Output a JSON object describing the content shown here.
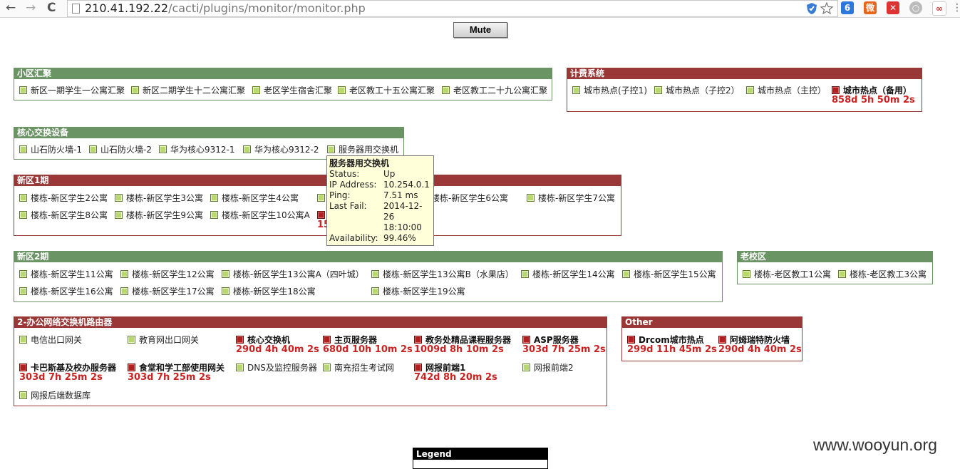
{
  "browser": {
    "url_host": "210.41.192.22",
    "url_path": "/cacti/plugins/monitor/monitor.php",
    "nav_back": "←",
    "nav_forward": "→",
    "nav_reload": "C"
  },
  "mute_label": "Mute",
  "colors": {
    "up_group": "#6b9465",
    "down_group": "#9a3838",
    "down_time": "#cc2222"
  },
  "groups": {
    "g1": {
      "title": "小区汇聚",
      "devices": [
        {
          "name": "新区一期学生一公寓汇聚",
          "status": "up"
        },
        {
          "name": "新区二期学生十二公寓汇聚",
          "status": "up"
        },
        {
          "name": "老区学生宿舍汇聚",
          "status": "up"
        },
        {
          "name": "老区教工十五公寓汇聚",
          "status": "up"
        },
        {
          "name": "老区教工二十九公寓汇聚",
          "status": "up"
        }
      ]
    },
    "g2": {
      "title": "计费系统",
      "devices": [
        {
          "name": "城市热点(子控1)",
          "status": "up"
        },
        {
          "name": "城市热点（子控2）",
          "status": "up"
        },
        {
          "name": "城市热点（主控）",
          "status": "up"
        },
        {
          "name": "城市热点（备用）",
          "status": "down",
          "downtime": "858d 5h 50m 2s"
        }
      ]
    },
    "g3": {
      "title": "核心交换设备",
      "devices": [
        {
          "name": "山石防火墙-1",
          "status": "up"
        },
        {
          "name": "山石防火墙-2",
          "status": "up"
        },
        {
          "name": "华为核心9312-1",
          "status": "up"
        },
        {
          "name": "华为核心9312-2",
          "status": "up"
        },
        {
          "name": "服务器用交换机",
          "status": "up"
        }
      ]
    },
    "g4": {
      "title": "新区1期",
      "devices": [
        {
          "name": "楼栋-新区学生2公寓",
          "status": "up"
        },
        {
          "name": "楼栋-新区学生3公寓",
          "status": "up"
        },
        {
          "name": "楼栋-新区学生4公寓",
          "status": "up"
        },
        {
          "name": "",
          "status": "up"
        },
        {
          "name": "楼栋-新区学生6公寓",
          "status": "up"
        },
        {
          "name": "楼栋-新区学生7公寓",
          "status": "up"
        },
        {
          "name": "楼栋-新区学生8公寓",
          "status": "up"
        },
        {
          "name": "楼栋-新区学生9公寓",
          "status": "up"
        },
        {
          "name": "楼栋-新区学生10公寓A",
          "status": "up"
        },
        {
          "name": "",
          "status": "down",
          "downtime": "15"
        }
      ]
    },
    "g5": {
      "title": "新区2期",
      "devices": [
        {
          "name": "楼栋-新区学生11公寓",
          "status": "up"
        },
        {
          "name": "楼栋-新区学生12公寓",
          "status": "up"
        },
        {
          "name": "楼栋-新区学生13公寓A（四叶城）",
          "status": "up"
        },
        {
          "name": "楼栋-新区学生13公寓B（水果店）",
          "status": "up"
        },
        {
          "name": "楼栋-新区学生14公寓",
          "status": "up"
        },
        {
          "name": "楼栋-新区学生15公寓",
          "status": "up"
        },
        {
          "name": "楼栋-新区学生16公寓",
          "status": "up"
        },
        {
          "name": "楼栋-新区学生17公寓",
          "status": "up"
        },
        {
          "name": "楼栋-新区学生18公寓",
          "status": "up"
        },
        {
          "name": "楼栋-新区学生19公寓",
          "status": "up"
        }
      ]
    },
    "g6": {
      "title": "老校区",
      "devices": [
        {
          "name": "楼栋-老区教工1公寓",
          "status": "up"
        },
        {
          "name": "楼栋-老区教工3公寓",
          "status": "up"
        }
      ]
    },
    "g7": {
      "title": "2-办公网络交换机路由器",
      "devices": [
        {
          "name": "电信出口网关",
          "status": "up"
        },
        {
          "name": "教育网出口网关",
          "status": "up"
        },
        {
          "name": "核心交换机",
          "status": "down",
          "downtime": "290d 4h 40m 2s"
        },
        {
          "name": "主页服务器",
          "status": "down",
          "downtime": "680d 10h 10m 2s"
        },
        {
          "name": "教务处精品课程服务器",
          "status": "down",
          "downtime": "1009d 8h 10m 2s"
        },
        {
          "name": "ASP服务器",
          "status": "down",
          "downtime": "303d 7h 25m 2s"
        },
        {
          "name": "卡巴斯基及校办服务器",
          "status": "down",
          "downtime": "303d 7h 25m 2s"
        },
        {
          "name": "食堂和学工部使用网关",
          "status": "down",
          "downtime": "303d 7h 25m 2s"
        },
        {
          "name": "DNS及监控服务器",
          "status": "up"
        },
        {
          "name": "南充招生考试网",
          "status": "up"
        },
        {
          "name": "网报前端1",
          "status": "down",
          "downtime": "742d 8h 20m 2s"
        },
        {
          "name": "网报前端2",
          "status": "up"
        },
        {
          "name": "网报后端数据库",
          "status": "up"
        }
      ]
    },
    "g8": {
      "title": "Other",
      "devices": [
        {
          "name": "Drcom城市热点",
          "status": "down",
          "downtime": "299d 11h 45m 2s"
        },
        {
          "name": "阿姆瑞特防火墙",
          "status": "down",
          "downtime": "290d 4h 40m 2s"
        }
      ]
    }
  },
  "tooltip": {
    "title": "服务器用交换机",
    "status_label": "Status:",
    "status": "Up",
    "ip_label": "IP Address:",
    "ip": "10.254.0.1",
    "ping_label": "Ping:",
    "ping": "7.51 ms",
    "lastfail_label": "Last Fail:",
    "lastfail_1": "2014-12-",
    "lastfail_2": "26",
    "lastfail_3": "18:10:00",
    "availability_label": "Availability:",
    "availability": "99.46%"
  },
  "legend_title": "Legend",
  "watermark": "www.wooyun.org"
}
